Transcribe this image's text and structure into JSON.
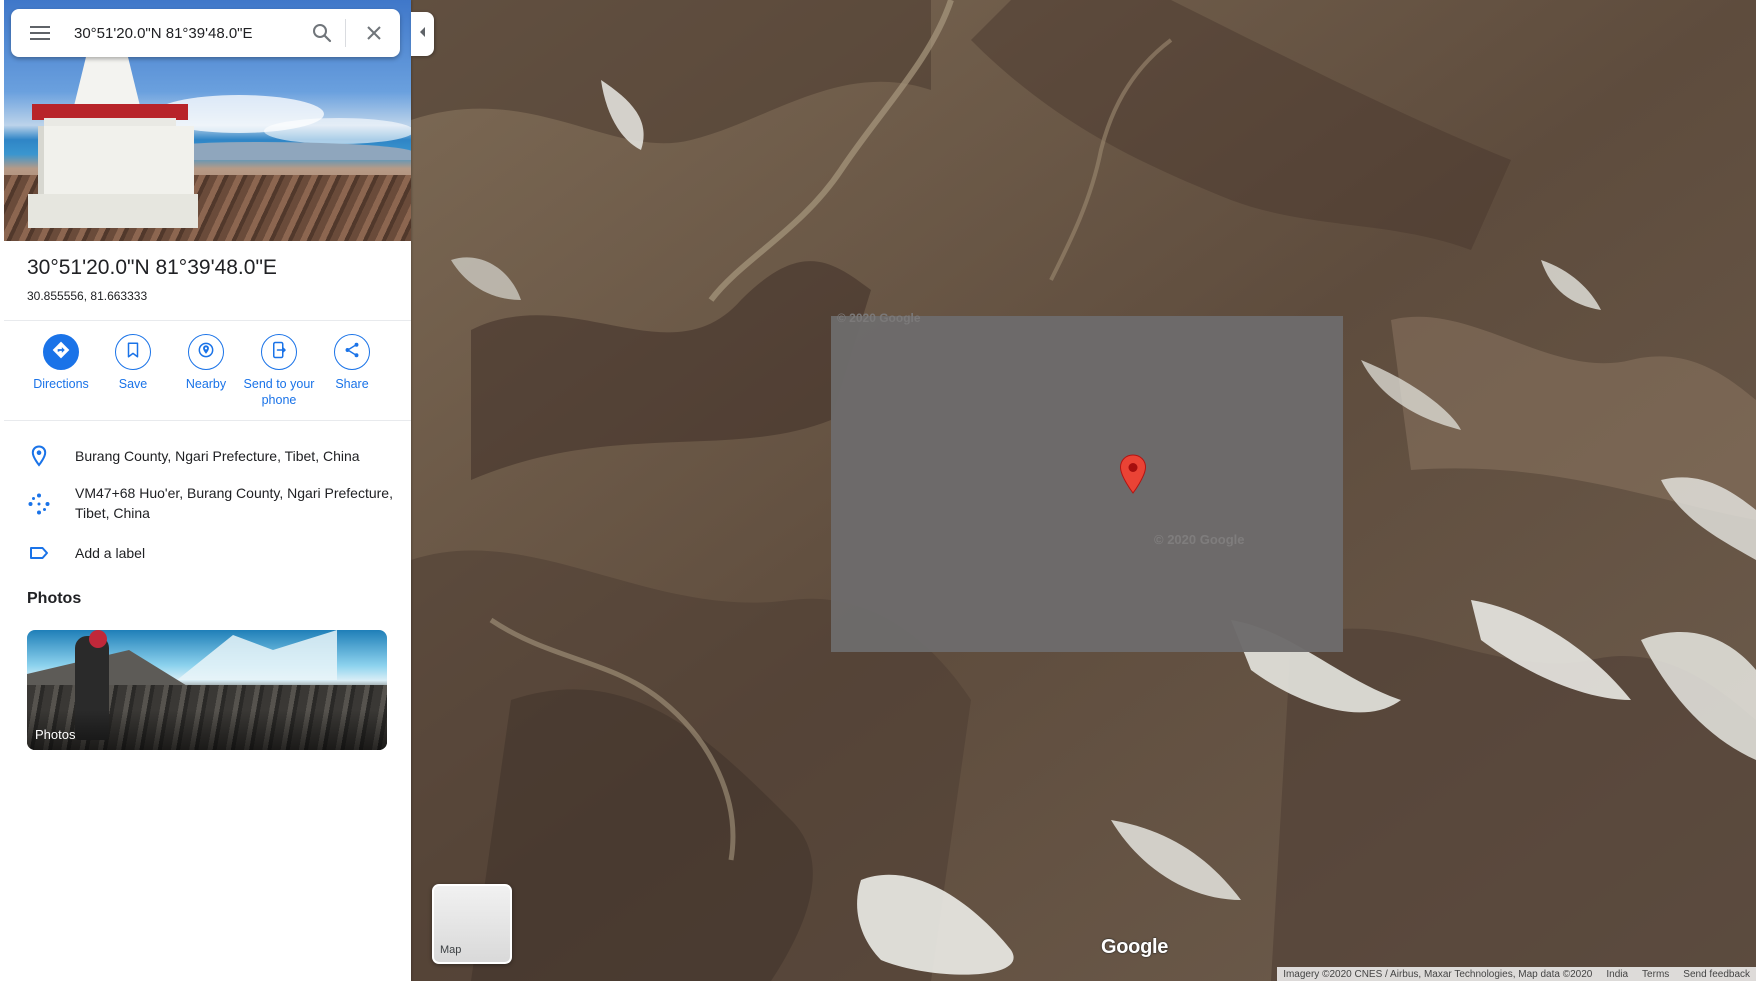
{
  "search": {
    "value": "30°51'20.0\"N 81°39'48.0\"E",
    "placeholder": "Search Google Maps"
  },
  "place": {
    "title": "30°51'20.0\"N 81°39'48.0\"E",
    "decimal_coords": "30.855556, 81.663333"
  },
  "actions": [
    {
      "label": "Directions",
      "icon": "directions-icon"
    },
    {
      "label": "Save",
      "icon": "bookmark-icon"
    },
    {
      "label": "Nearby",
      "icon": "nearby-icon"
    },
    {
      "label": "Send to your phone",
      "icon": "send-to-phone-icon"
    },
    {
      "label": "Share",
      "icon": "share-icon"
    }
  ],
  "info": {
    "address": "Burang County, Ngari Prefecture, Tibet, China",
    "plus_code": "VM47+68 Huo'er, Burang County, Ngari Prefecture, Tibet, China",
    "label_action": "Add a label"
  },
  "photos": {
    "heading": "Photos",
    "card_label": "Photos"
  },
  "map": {
    "layer_toggle_label": "Map",
    "logo": "Google",
    "tile_watermark": "© 2020 Google",
    "tile_watermark_top": "© 2020 Google",
    "attribution": {
      "imagery": "Imagery ©2020 CNES / Airbus, Maxar Technologies, Map data ©2020",
      "country": "India",
      "terms": "Terms",
      "feedback": "Send feedback"
    }
  },
  "colors": {
    "accent": "#1a73e8",
    "pin": "#ea4335",
    "text": "#202124"
  }
}
